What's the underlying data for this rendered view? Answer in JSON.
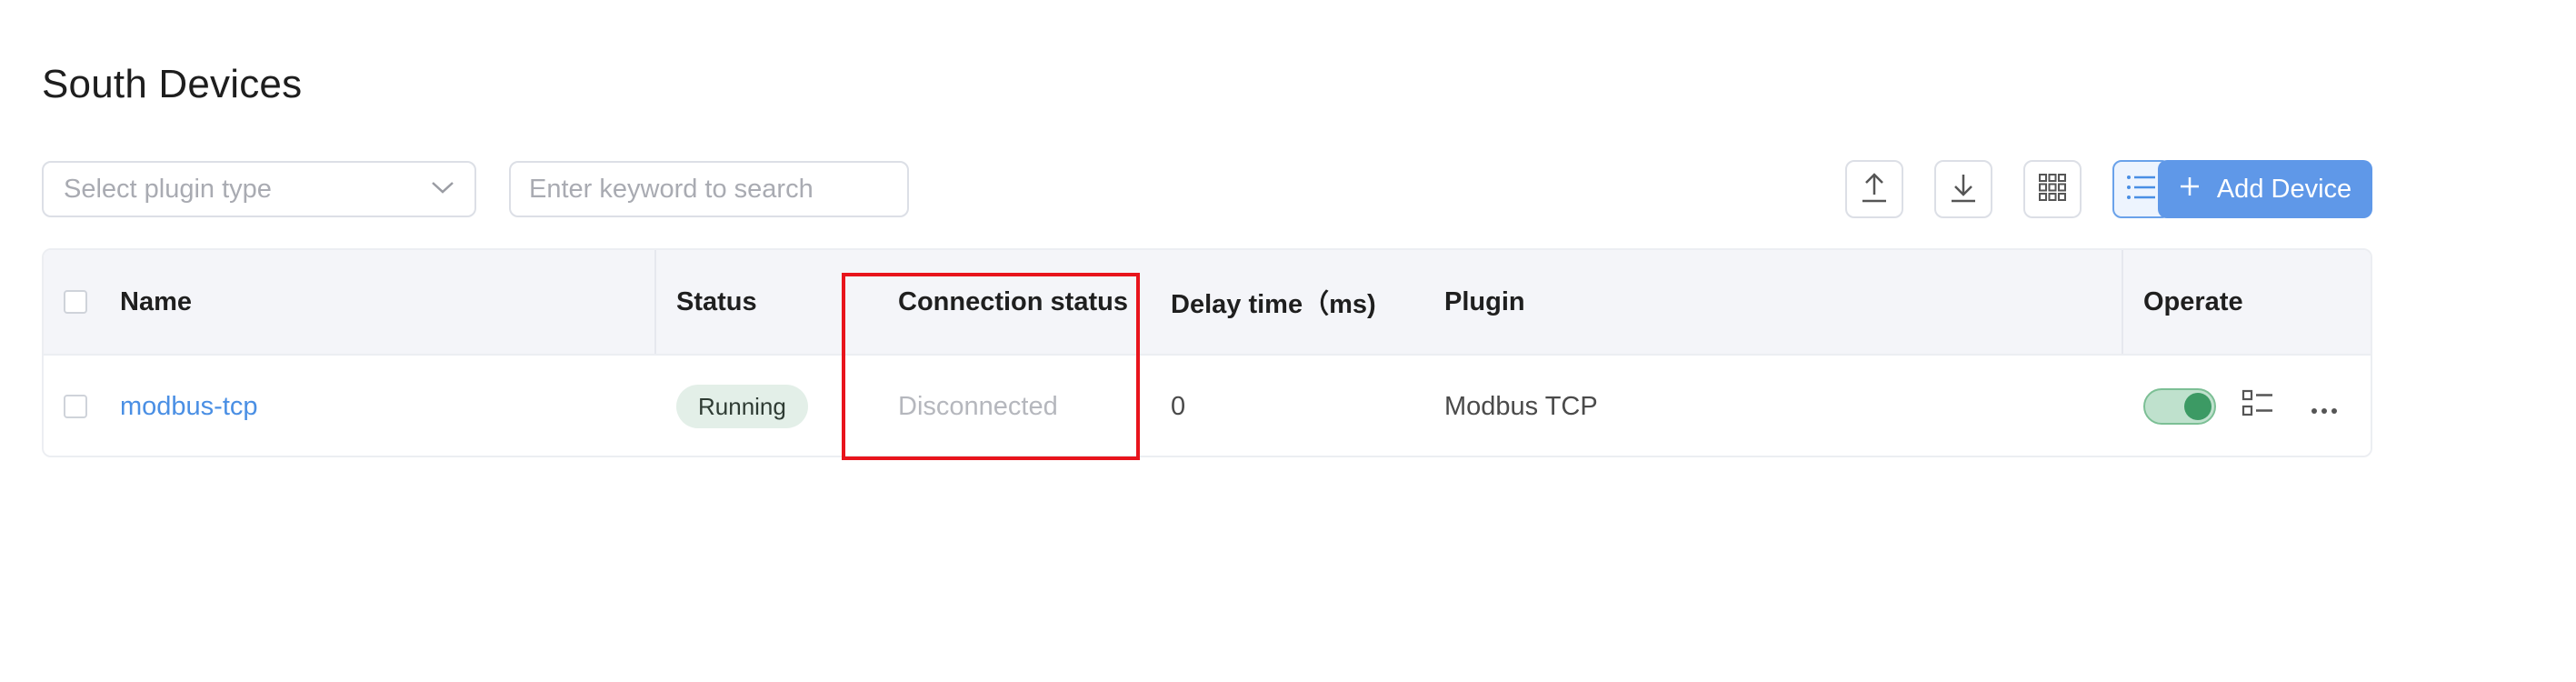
{
  "page": {
    "title": "South Devices"
  },
  "toolbar": {
    "plugin_select_placeholder": "Select plugin type",
    "search_placeholder": "Enter keyword to search",
    "upload_icon": "upload-icon",
    "download_icon": "download-icon",
    "grid_view_icon": "grid-view-icon",
    "list_view_icon": "list-view-icon",
    "list_view_active": true,
    "add_button_label": "Add Device",
    "accent_color": "#5f98e8"
  },
  "table": {
    "columns": [
      {
        "label": "Name"
      },
      {
        "label": "Status"
      },
      {
        "label": "Connection status"
      },
      {
        "label": "Delay time（ms)"
      },
      {
        "label": "Plugin"
      },
      {
        "label": "Operate"
      }
    ],
    "rows": [
      {
        "name": "modbus-tcp",
        "status": "Running",
        "connection_status": "Disconnected",
        "delay_time": "0",
        "plugin": "Modbus TCP",
        "enabled": true
      }
    ]
  },
  "annotation": {
    "highlight_color": "#e8141c",
    "highlighted_column": "Connection status"
  }
}
